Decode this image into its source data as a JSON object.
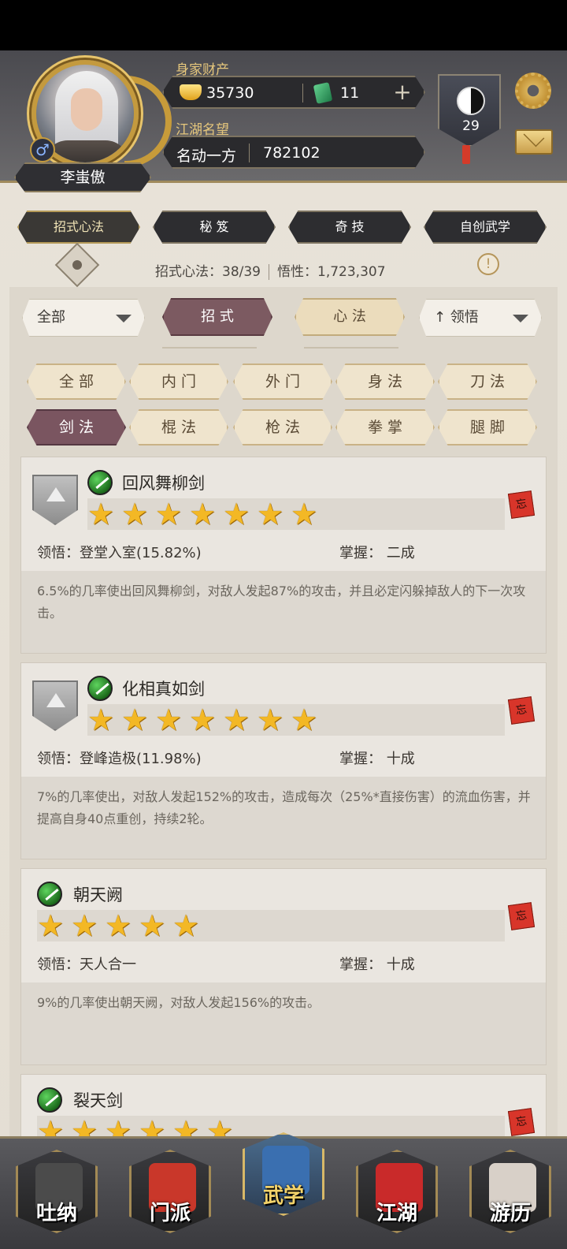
{
  "player": {
    "name": "李蚩傲",
    "gender_symbol": "♂"
  },
  "wealth": {
    "label": "身家财产",
    "gold": "35730",
    "jade": "11",
    "plus": "+"
  },
  "fame": {
    "label": "江湖名望",
    "title": "名动一方",
    "value": "782102"
  },
  "level": "29",
  "main_tabs": [
    {
      "label": "招式心法",
      "active": true
    },
    {
      "label": "秘 笈",
      "active": false
    },
    {
      "label": "奇 技",
      "active": false
    },
    {
      "label": "自创武学",
      "active": false
    }
  ],
  "stats": {
    "moves": "招式心法：38/39",
    "insight": "悟性：1,723,307"
  },
  "info_mark": "!",
  "filters": {
    "scope_dropdown": "全部",
    "seg_moves": "招 式",
    "seg_mind": "心 法",
    "sort_dropdown": "↑ 领悟"
  },
  "categories": [
    [
      "全 部",
      "内 门",
      "外 门",
      "身 法",
      "刀 法"
    ],
    [
      "剑 法",
      "棍 法",
      "枪 法",
      "拳 掌",
      "腿 脚"
    ]
  ],
  "active_category": "剑 法",
  "skills": [
    {
      "name": "回风舞柳剑",
      "stars": 7,
      "has_badge": true,
      "comprehension": "领悟：登堂入室(15.82%)",
      "mastery": "掌握：  二成",
      "description": "6.5%的几率使出回风舞柳剑，对敌人发起87%的攻击，并且必定闪躲掉敌人的下一次攻击。",
      "forget": "忘"
    },
    {
      "name": "化相真如剑",
      "stars": 7,
      "has_badge": true,
      "comprehension": "领悟：登峰造极(11.98%)",
      "mastery": "掌握：  十成",
      "description": "7%的几率使出，对敌人发起152%的攻击，造成每次（25%*直接伤害）的流血伤害，并提高自身40点重创，持续2轮。",
      "forget": "忘"
    },
    {
      "name": "朝天阙",
      "stars": 5,
      "has_badge": false,
      "comprehension": "领悟：天人合一",
      "mastery": "掌握：  十成",
      "description": "9%的几率使出朝天阙，对敌人发起156%的攻击。",
      "forget": "忘"
    },
    {
      "name": "裂天剑",
      "stars": 6,
      "has_badge": false,
      "comprehension": "",
      "mastery": "",
      "description": "",
      "forget": "忘"
    }
  ],
  "bottom_nav": [
    {
      "label": "吐纳",
      "active": false,
      "color": "#4b4b4b"
    },
    {
      "label": "门派",
      "active": false,
      "color": "#c9372a"
    },
    {
      "label": "武学",
      "active": true,
      "color": "#3a6fb0"
    },
    {
      "label": "江湖",
      "active": false,
      "color": "#c92a2a"
    },
    {
      "label": "游历",
      "active": false,
      "color": "#d8d0c8"
    }
  ]
}
